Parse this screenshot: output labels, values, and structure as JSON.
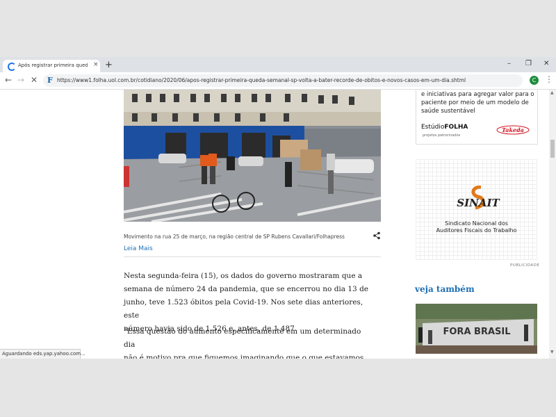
{
  "browser": {
    "tab_title": "Após registrar primeira queda se",
    "tab_close": "×",
    "new_tab": "+",
    "window_controls": {
      "minimize": "–",
      "maximize": "❐",
      "close": "✕"
    },
    "nav": {
      "back": "←",
      "forward": "→",
      "reload": "✕"
    },
    "url": "https://www1.folha.uol.com.br/cotidiano/2020/06/apos-registrar-primeira-queda-semanal-sp-volta-a-bater-recorde-de-obitos-e-novos-casos-em-um-dia.shtml",
    "favicon_letter": "F",
    "profile_initial": "C",
    "menu_icon": "⋮"
  },
  "article": {
    "caption": "Movimento na rua 25 de março, na região central de SP Rubens Cavallari/Folhapress",
    "leia_mais": "Leia Mais",
    "paragraphs": [
      [
        "Nesta segunda-feira (15), os dados do governo mostraram que a",
        "semana de número 24 da pandemia, que se encerrou no dia 13 de",
        "junho, teve 1.523 óbitos pela Covid-19. Nos sete dias anteriores, este",
        "número havia sido de 1.526 e, antes, de 1.487."
      ],
      [
        "\"Essa questão do aumento especificamente em um determinado dia",
        "não é motivo pra que fiquemos imaginando que o que estavamos"
      ]
    ]
  },
  "sidebar": {
    "ad1_lines": [
      "e iniciativas para agregar valor para o",
      "paciente por meio de um modelo de",
      "saúde sustentável"
    ],
    "ad1_brand_a": "Estúdio",
    "ad1_brand_b": "FOLHA",
    "ad1_sub": "projetos patrocinados",
    "ad1_sponsor": "Takeda",
    "ad2_logo_text": "SINAIT",
    "ad2_line1": "Sindicato Nacional dos",
    "ad2_line2": "Auditores Fiscais do Trabalho",
    "publicidade": "PUBLICIDADE",
    "veja_tambem": "veja também",
    "thumb_graffiti": "FORA BRASIL"
  },
  "status": "Aguardando eds.yap.yahoo.com...",
  "colors": {
    "link_blue": "#1c6fb5",
    "building_blue": "#1d4fa0"
  }
}
